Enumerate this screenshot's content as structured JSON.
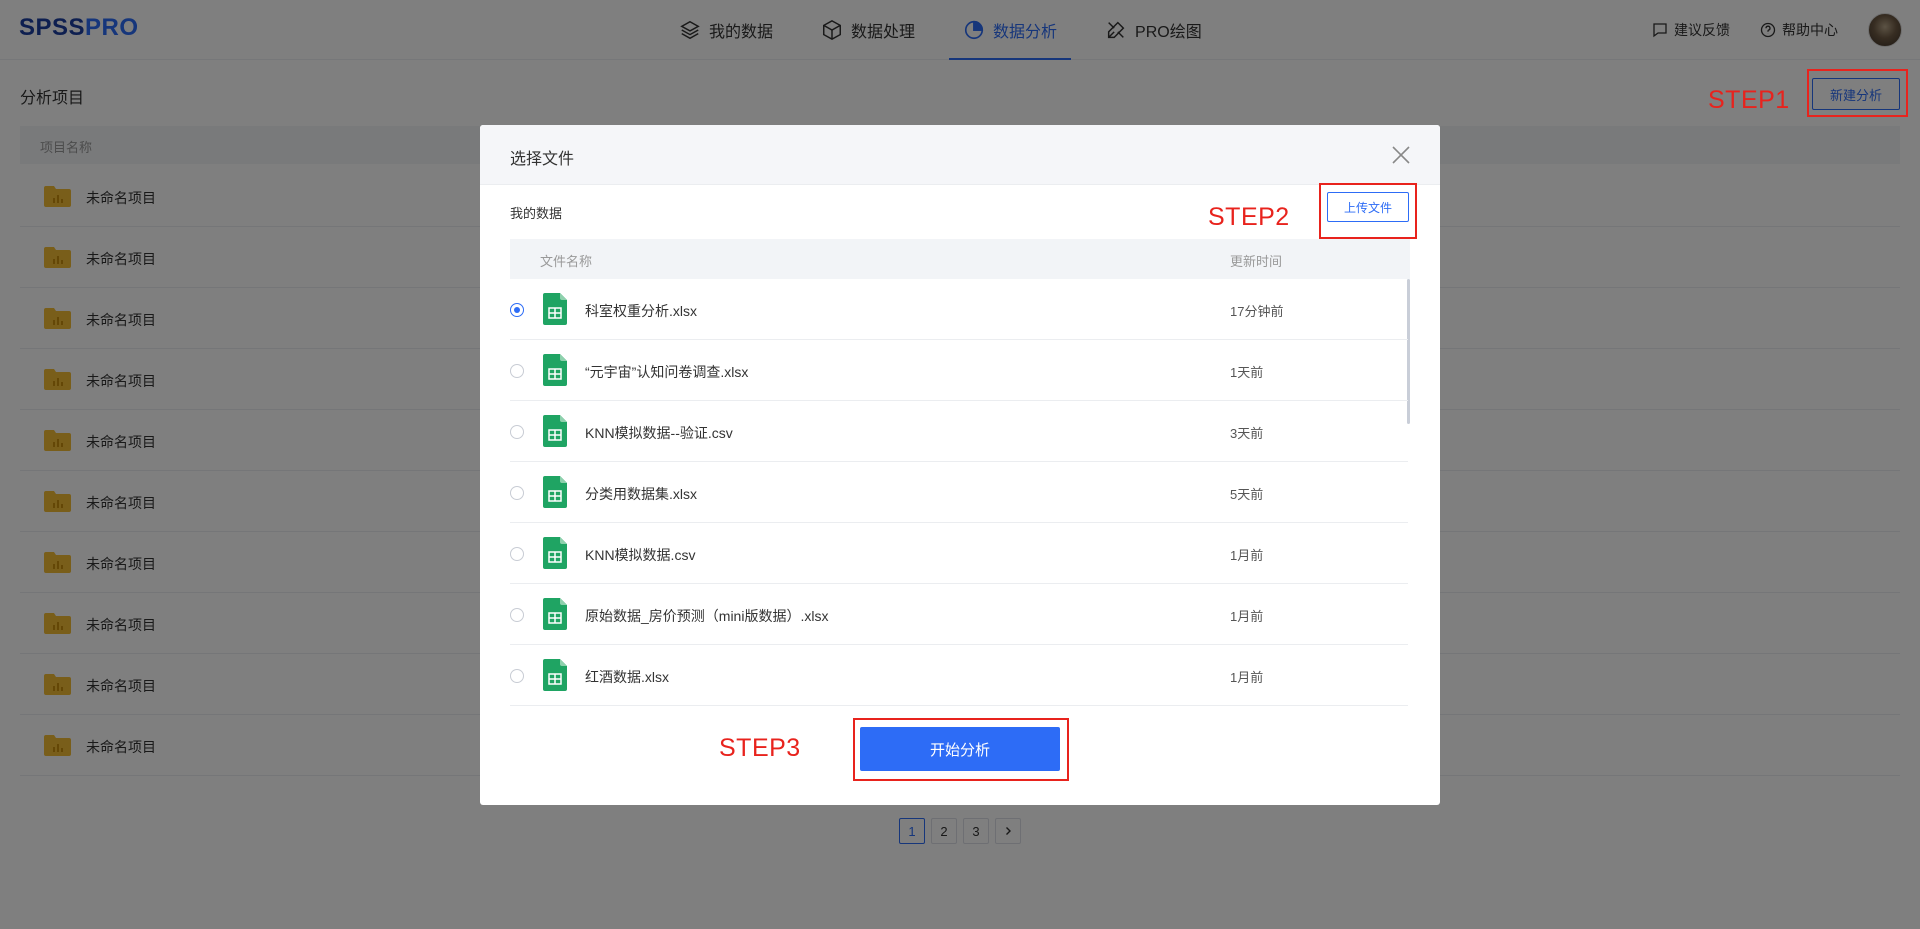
{
  "header": {
    "logo": "SPSSPRO",
    "tabs": [
      {
        "label": "我的数据",
        "icon": "layers-icon"
      },
      {
        "label": "数据处理",
        "icon": "cube-icon"
      },
      {
        "label": "数据分析",
        "icon": "pie-chart-icon",
        "active": true
      },
      {
        "label": "PRO绘图",
        "icon": "drawing-tools-icon"
      }
    ],
    "feedback": "建议反馈",
    "help": "帮助中心"
  },
  "page": {
    "title": "分析项目",
    "new_button": "新建分析",
    "column_name": "项目名称",
    "projects": [
      "未命名项目",
      "未命名项目",
      "未命名项目",
      "未命名项目",
      "未命名项目",
      "未命名项目",
      "未命名项目",
      "未命名项目",
      "未命名项目",
      "未命名项目"
    ],
    "pagination": [
      "1",
      "2",
      "3"
    ],
    "current_page": "1"
  },
  "modal": {
    "title": "选择文件",
    "section": "我的数据",
    "upload_button": "上传文件",
    "col_filename": "文件名称",
    "col_updated": "更新时间",
    "files": [
      {
        "name": "科室权重分析.xlsx",
        "time": "17分钟前",
        "selected": true
      },
      {
        "name": "“元宇宙”认知问卷调查.xlsx",
        "time": "1天前",
        "selected": false
      },
      {
        "name": "KNN模拟数据--验证.csv",
        "time": "3天前",
        "selected": false
      },
      {
        "name": "分类用数据集.xlsx",
        "time": "5天前",
        "selected": false
      },
      {
        "name": "KNN模拟数据.csv",
        "time": "1月前",
        "selected": false
      },
      {
        "name": "原始数据_房价预测（mini版数据）.xlsx",
        "time": "1月前",
        "selected": false
      },
      {
        "name": "红酒数据.xlsx",
        "time": "1月前",
        "selected": false
      }
    ],
    "start_button": "开始分析"
  },
  "annotations": {
    "step1": "STEP1",
    "step2": "STEP2",
    "step3": "STEP3",
    "color": "#e8231d"
  },
  "colors": {
    "primary": "#2d6cf6",
    "file_icon": "#1fa463"
  }
}
